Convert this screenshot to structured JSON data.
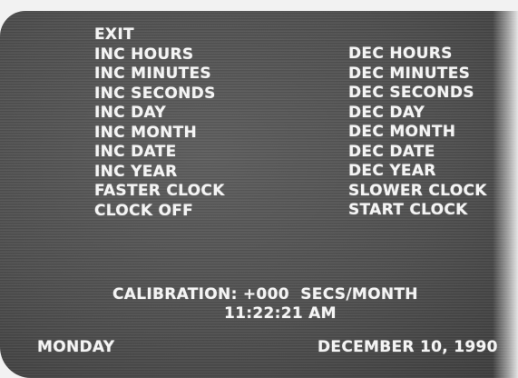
{
  "left_menu": [
    "EXIT",
    "INC HOURS",
    "INC MINUTES",
    "INC SECONDS",
    "INC DAY",
    "INC MONTH",
    "INC DATE",
    "INC YEAR",
    "FASTER CLOCK",
    "CLOCK OFF"
  ],
  "right_menu": [
    "DEC HOURS",
    "DEC MINUTES",
    "DEC SECONDS",
    "DEC DAY",
    "DEC MONTH",
    "DEC DATE",
    "DEC YEAR",
    "SLOWER CLOCK",
    "START CLOCK"
  ],
  "status": {
    "calibration": "CALIBRATION: +000  SECS/MONTH",
    "time": "11:22:21 AM",
    "day": "MONDAY",
    "date": "DECEMBER 10, 1990"
  }
}
